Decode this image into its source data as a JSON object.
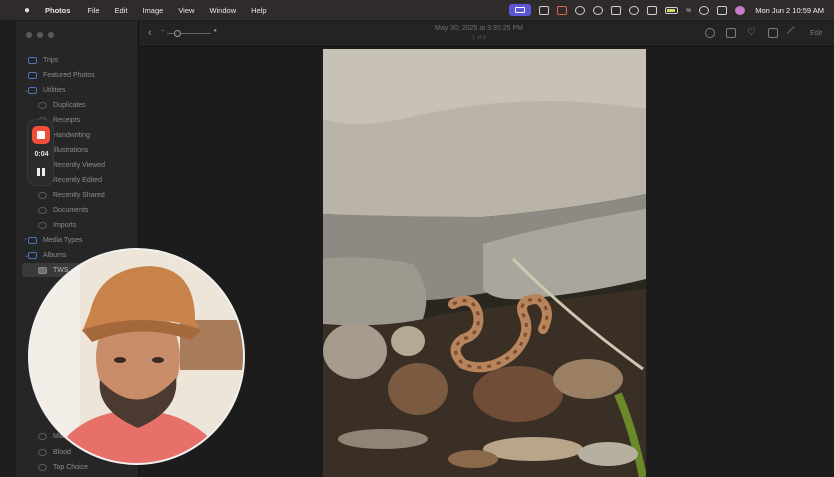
{
  "menubar": {
    "app_name": "Photos",
    "menus": [
      "File",
      "Edit",
      "Image",
      "View",
      "Window",
      "Help"
    ],
    "clock": "Mon Jun 2  10:59 AM",
    "status_icons": [
      "screen-record-icon",
      "airplay-icon",
      "extension-icon",
      "vpn-icon",
      "grammarly-icon",
      "grid-icon",
      "chat-icon",
      "scissors-icon",
      "battery-icon",
      "wifi-icon",
      "search-icon",
      "control-center-icon",
      "siri-icon"
    ]
  },
  "sidebar": {
    "items": [
      {
        "label": "Trips",
        "level": 0
      },
      {
        "label": "Featured Photos",
        "level": 0
      },
      {
        "label": "Utilities",
        "level": 0,
        "expandable": true
      },
      {
        "label": "Duplicates",
        "level": 1
      },
      {
        "label": "Receipts",
        "level": 1
      },
      {
        "label": "Handwriting",
        "level": 1
      },
      {
        "label": "Illustrations",
        "level": 1
      },
      {
        "label": "Recently Viewed",
        "level": 1
      },
      {
        "label": "Recently Edited",
        "level": 1
      },
      {
        "label": "Recently Shared",
        "level": 1
      },
      {
        "label": "Documents",
        "level": 1
      },
      {
        "label": "Imports",
        "level": 1
      },
      {
        "label": "Media Types",
        "level": 0,
        "expandable": true
      },
      {
        "label": "Albums",
        "level": 0,
        "expandable": true
      },
      {
        "label": "TWS",
        "level": 1,
        "selected": true
      },
      {
        "label": "Mar",
        "level": 1
      },
      {
        "label": "Blood",
        "level": 1
      },
      {
        "label": "Top Choice",
        "level": 1
      }
    ]
  },
  "toolbar": {
    "date": "May 30, 2025 at 3:35:25 PM",
    "count": "1 of 8",
    "edit_label": "Edit"
  },
  "recorder": {
    "time": "0:04"
  },
  "colors": {
    "accent": "#5b57d8",
    "record": "#f0503a",
    "sidebar_icon": "#4b73b8"
  }
}
